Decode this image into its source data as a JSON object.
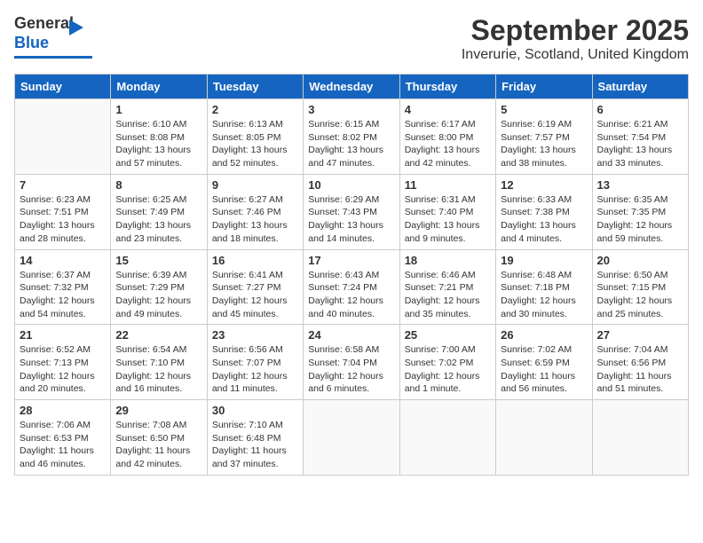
{
  "header": {
    "logo": {
      "line1": "General",
      "line2": "Blue"
    },
    "title": "September 2025",
    "subtitle": "Inverurie, Scotland, United Kingdom"
  },
  "calendar": {
    "days_of_week": [
      "Sunday",
      "Monday",
      "Tuesday",
      "Wednesday",
      "Thursday",
      "Friday",
      "Saturday"
    ],
    "weeks": [
      [
        {
          "day": "",
          "info": ""
        },
        {
          "day": "1",
          "info": "Sunrise: 6:10 AM\nSunset: 8:08 PM\nDaylight: 13 hours\nand 57 minutes."
        },
        {
          "day": "2",
          "info": "Sunrise: 6:13 AM\nSunset: 8:05 PM\nDaylight: 13 hours\nand 52 minutes."
        },
        {
          "day": "3",
          "info": "Sunrise: 6:15 AM\nSunset: 8:02 PM\nDaylight: 13 hours\nand 47 minutes."
        },
        {
          "day": "4",
          "info": "Sunrise: 6:17 AM\nSunset: 8:00 PM\nDaylight: 13 hours\nand 42 minutes."
        },
        {
          "day": "5",
          "info": "Sunrise: 6:19 AM\nSunset: 7:57 PM\nDaylight: 13 hours\nand 38 minutes."
        },
        {
          "day": "6",
          "info": "Sunrise: 6:21 AM\nSunset: 7:54 PM\nDaylight: 13 hours\nand 33 minutes."
        }
      ],
      [
        {
          "day": "7",
          "info": "Sunrise: 6:23 AM\nSunset: 7:51 PM\nDaylight: 13 hours\nand 28 minutes."
        },
        {
          "day": "8",
          "info": "Sunrise: 6:25 AM\nSunset: 7:49 PM\nDaylight: 13 hours\nand 23 minutes."
        },
        {
          "day": "9",
          "info": "Sunrise: 6:27 AM\nSunset: 7:46 PM\nDaylight: 13 hours\nand 18 minutes."
        },
        {
          "day": "10",
          "info": "Sunrise: 6:29 AM\nSunset: 7:43 PM\nDaylight: 13 hours\nand 14 minutes."
        },
        {
          "day": "11",
          "info": "Sunrise: 6:31 AM\nSunset: 7:40 PM\nDaylight: 13 hours\nand 9 minutes."
        },
        {
          "day": "12",
          "info": "Sunrise: 6:33 AM\nSunset: 7:38 PM\nDaylight: 13 hours\nand 4 minutes."
        },
        {
          "day": "13",
          "info": "Sunrise: 6:35 AM\nSunset: 7:35 PM\nDaylight: 12 hours\nand 59 minutes."
        }
      ],
      [
        {
          "day": "14",
          "info": "Sunrise: 6:37 AM\nSunset: 7:32 PM\nDaylight: 12 hours\nand 54 minutes."
        },
        {
          "day": "15",
          "info": "Sunrise: 6:39 AM\nSunset: 7:29 PM\nDaylight: 12 hours\nand 49 minutes."
        },
        {
          "day": "16",
          "info": "Sunrise: 6:41 AM\nSunset: 7:27 PM\nDaylight: 12 hours\nand 45 minutes."
        },
        {
          "day": "17",
          "info": "Sunrise: 6:43 AM\nSunset: 7:24 PM\nDaylight: 12 hours\nand 40 minutes."
        },
        {
          "day": "18",
          "info": "Sunrise: 6:46 AM\nSunset: 7:21 PM\nDaylight: 12 hours\nand 35 minutes."
        },
        {
          "day": "19",
          "info": "Sunrise: 6:48 AM\nSunset: 7:18 PM\nDaylight: 12 hours\nand 30 minutes."
        },
        {
          "day": "20",
          "info": "Sunrise: 6:50 AM\nSunset: 7:15 PM\nDaylight: 12 hours\nand 25 minutes."
        }
      ],
      [
        {
          "day": "21",
          "info": "Sunrise: 6:52 AM\nSunset: 7:13 PM\nDaylight: 12 hours\nand 20 minutes."
        },
        {
          "day": "22",
          "info": "Sunrise: 6:54 AM\nSunset: 7:10 PM\nDaylight: 12 hours\nand 16 minutes."
        },
        {
          "day": "23",
          "info": "Sunrise: 6:56 AM\nSunset: 7:07 PM\nDaylight: 12 hours\nand 11 minutes."
        },
        {
          "day": "24",
          "info": "Sunrise: 6:58 AM\nSunset: 7:04 PM\nDaylight: 12 hours\nand 6 minutes."
        },
        {
          "day": "25",
          "info": "Sunrise: 7:00 AM\nSunset: 7:02 PM\nDaylight: 12 hours\nand 1 minute."
        },
        {
          "day": "26",
          "info": "Sunrise: 7:02 AM\nSunset: 6:59 PM\nDaylight: 11 hours\nand 56 minutes."
        },
        {
          "day": "27",
          "info": "Sunrise: 7:04 AM\nSunset: 6:56 PM\nDaylight: 11 hours\nand 51 minutes."
        }
      ],
      [
        {
          "day": "28",
          "info": "Sunrise: 7:06 AM\nSunset: 6:53 PM\nDaylight: 11 hours\nand 46 minutes."
        },
        {
          "day": "29",
          "info": "Sunrise: 7:08 AM\nSunset: 6:50 PM\nDaylight: 11 hours\nand 42 minutes."
        },
        {
          "day": "30",
          "info": "Sunrise: 7:10 AM\nSunset: 6:48 PM\nDaylight: 11 hours\nand 37 minutes."
        },
        {
          "day": "",
          "info": ""
        },
        {
          "day": "",
          "info": ""
        },
        {
          "day": "",
          "info": ""
        },
        {
          "day": "",
          "info": ""
        }
      ]
    ]
  }
}
